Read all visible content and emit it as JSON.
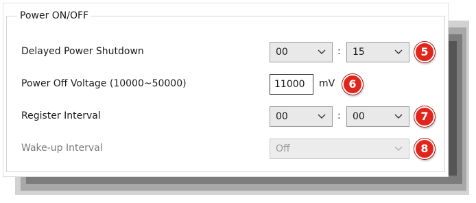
{
  "group_title": "Power ON/OFF",
  "rows": {
    "delayed_shutdown": {
      "label": "Delayed Power Shutdown",
      "hours": "00",
      "separator": ":",
      "minutes": "15",
      "badge": "5"
    },
    "power_off_voltage": {
      "label": "Power Off Voltage (10000~50000)",
      "value": "11000",
      "unit": "mV",
      "badge": "6"
    },
    "register_interval": {
      "label": "Register Interval",
      "hours": "00",
      "separator": ":",
      "minutes": "00",
      "badge": "7"
    },
    "wakeup_interval": {
      "label": "Wake-up Interval",
      "value": "Off",
      "disabled": true,
      "badge": "8"
    }
  },
  "icons": {
    "dropdown": "chevron-down-icon"
  },
  "colors": {
    "badge": "#e0261c",
    "combo_background": "#e9e9e9",
    "disabled_text": "#9a9a9a"
  }
}
